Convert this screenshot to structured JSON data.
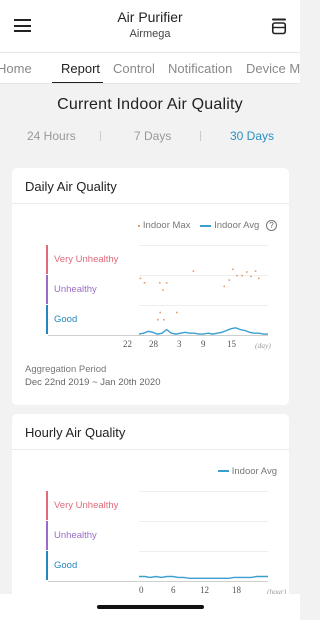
{
  "header": {
    "title": "Air Purifier",
    "subtitle": "Airmega"
  },
  "tabs": [
    {
      "label": "Home",
      "active": false
    },
    {
      "label": "Report",
      "active": true
    },
    {
      "label": "Control",
      "active": false
    },
    {
      "label": "Notification",
      "active": false
    },
    {
      "label": "Device M",
      "active": false
    }
  ],
  "report": {
    "title": "Current Indoor Air Quality",
    "periods": [
      {
        "label": "24 Hours",
        "active": false
      },
      {
        "label": "7 Days",
        "active": false
      },
      {
        "label": "30 Days",
        "active": true
      }
    ]
  },
  "daily": {
    "title": "Daily Air Quality",
    "legend": {
      "max": "Indoor Max",
      "avg": "Indoor Avg",
      "help": "?"
    },
    "bands": {
      "very_unhealthy": "Very Unhealthy",
      "unhealthy": "Unhealthy",
      "good": "Good"
    },
    "x_ticks": [
      "22",
      "28",
      "3",
      "9",
      "15"
    ],
    "x_unit": "(day)",
    "aggregation_label": "Aggregation Period",
    "aggregation_range": "Dec 22nd 2019 ~ Jan 20th 2020"
  },
  "hourly": {
    "title": "Hourly Air Quality",
    "legend": {
      "avg": "Indoor Avg"
    },
    "bands": {
      "very_unhealthy": "Very Unhealthy",
      "unhealthy": "Unhealthy",
      "good": "Good"
    },
    "x_ticks": [
      "0",
      "6",
      "12",
      "18"
    ],
    "x_unit": "(hour)"
  },
  "colors": {
    "very_unhealthy": "#e1697a",
    "unhealthy": "#9a6cc6",
    "good": "#2587c0",
    "indoor_max": "#e89a6f",
    "indoor_avg": "#3a9fd0",
    "accent": "#2d8fc4"
  },
  "chart_data": [
    {
      "type": "scatter",
      "title": "Daily Air Quality",
      "x_unit": "day",
      "categories": [
        "Very Unhealthy",
        "Unhealthy",
        "Good"
      ],
      "x_ticks": [
        "22",
        "28",
        "3",
        "9",
        "15"
      ],
      "series": [
        {
          "name": "Indoor Max",
          "style": "points",
          "values": [
            [
              0.3,
              0.63
            ],
            [
              1.2,
              0.58
            ],
            [
              4.5,
              0.58
            ],
            [
              6.0,
              0.58
            ],
            [
              5.2,
              0.5
            ],
            [
              11.8,
              0.71
            ],
            [
              4.6,
              0.25
            ],
            [
              4.1,
              0.17
            ],
            [
              5.4,
              0.17
            ],
            [
              8.2,
              0.25
            ],
            [
              18.5,
              0.54
            ],
            [
              19.6,
              0.61
            ],
            [
              20.4,
              0.73
            ],
            [
              21.3,
              0.66
            ],
            [
              22.4,
              0.66
            ],
            [
              23.4,
              0.7
            ],
            [
              24.3,
              0.65
            ],
            [
              25.3,
              0.71
            ],
            [
              26.0,
              0.63
            ]
          ]
        },
        {
          "name": "Indoor Avg",
          "style": "line",
          "values": [
            [
              0,
              0.01
            ],
            [
              1,
              0.02
            ],
            [
              2,
              0.04
            ],
            [
              3,
              0.03
            ],
            [
              4,
              0.01
            ],
            [
              5,
              0.02
            ],
            [
              6,
              0.06
            ],
            [
              7,
              0.02
            ],
            [
              8,
              0.01
            ],
            [
              9,
              0.02
            ],
            [
              10,
              0.03
            ],
            [
              11,
              0.02
            ],
            [
              12,
              0.02
            ],
            [
              13,
              0.01
            ],
            [
              14,
              0.01
            ],
            [
              15,
              0.02
            ],
            [
              16,
              0.01
            ],
            [
              17,
              0.02
            ],
            [
              18,
              0.03
            ],
            [
              19,
              0.05
            ],
            [
              20,
              0.07
            ],
            [
              21,
              0.08
            ],
            [
              22,
              0.06
            ],
            [
              23,
              0.05
            ],
            [
              24,
              0.03
            ],
            [
              25,
              0.02
            ],
            [
              26,
              0.02
            ],
            [
              27,
              0.01
            ],
            [
              28,
              0.01
            ]
          ]
        }
      ]
    },
    {
      "type": "line",
      "title": "Hourly Air Quality",
      "x_unit": "hour",
      "categories": [
        "Very Unhealthy",
        "Unhealthy",
        "Good"
      ],
      "x_ticks": [
        "0",
        "6",
        "12",
        "18"
      ],
      "series": [
        {
          "name": "Indoor Avg",
          "values": [
            [
              0,
              0.05
            ],
            [
              1,
              0.05
            ],
            [
              2,
              0.04
            ],
            [
              3,
              0.05
            ],
            [
              4,
              0.04
            ],
            [
              5,
              0.05
            ],
            [
              6,
              0.05
            ],
            [
              7,
              0.04
            ],
            [
              8,
              0.04
            ],
            [
              9,
              0.03
            ],
            [
              10,
              0.03
            ],
            [
              11,
              0.03
            ],
            [
              12,
              0.03
            ],
            [
              13,
              0.03
            ],
            [
              14,
              0.03
            ],
            [
              15,
              0.03
            ],
            [
              16,
              0.03
            ],
            [
              17,
              0.04
            ],
            [
              18,
              0.04
            ],
            [
              19,
              0.04
            ],
            [
              20,
              0.04
            ],
            [
              21,
              0.05
            ],
            [
              22,
              0.05
            ],
            [
              23,
              0.05
            ]
          ]
        }
      ]
    }
  ]
}
